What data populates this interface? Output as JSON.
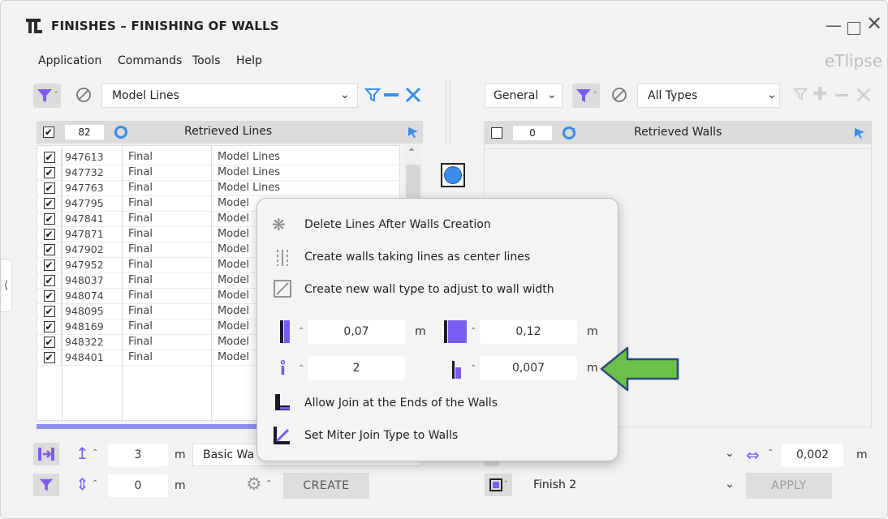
{
  "window": {
    "title": "FINISHES – FINISHING OF WALLS",
    "controls": [
      "minimize",
      "maximize",
      "close"
    ],
    "logo_text": "eTlipse"
  },
  "menu": [
    "Application",
    "Commands",
    "Tools",
    "Help"
  ],
  "left_toolbar": {
    "filter_dropdown_value": "Model Lines",
    "icons": [
      "filter-icon",
      "no-filter-icon",
      "chevron-down-icon",
      "filter-blue-icon",
      "minus-icon",
      "clear-icon"
    ]
  },
  "left_panel": {
    "select_all_checked": true,
    "count": "82",
    "header": "Retrieved Lines",
    "rows": [
      {
        "id": "947613",
        "status": "Final",
        "type": "Model Lines"
      },
      {
        "id": "947732",
        "status": "Final",
        "type": "Model Lines"
      },
      {
        "id": "947763",
        "status": "Final",
        "type": "Model Lines"
      },
      {
        "id": "947795",
        "status": "Final",
        "type": "Model"
      },
      {
        "id": "947841",
        "status": "Final",
        "type": "Model"
      },
      {
        "id": "947871",
        "status": "Final",
        "type": "Model"
      },
      {
        "id": "947902",
        "status": "Final",
        "type": "Model"
      },
      {
        "id": "947952",
        "status": "Final",
        "type": "Model"
      },
      {
        "id": "948037",
        "status": "Final",
        "type": "Model"
      },
      {
        "id": "948074",
        "status": "Final",
        "type": "Model"
      },
      {
        "id": "948095",
        "status": "Final",
        "type": "Model"
      },
      {
        "id": "948169",
        "status": "Final",
        "type": "Model"
      },
      {
        "id": "948322",
        "status": "Final",
        "type": "Model"
      },
      {
        "id": "948401",
        "status": "Final",
        "type": "Model"
      }
    ]
  },
  "right_toolbar": {
    "category_value": "General",
    "types_value": "All Types"
  },
  "right_panel": {
    "select_all_checked": false,
    "count": "0",
    "header": "Retrieved Walls"
  },
  "popup": {
    "options": [
      {
        "icon": "asterisk-delete-icon",
        "label": "Delete Lines After Walls Creation"
      },
      {
        "icon": "center-lines-icon",
        "label": "Create walls taking lines as center lines"
      },
      {
        "icon": "new-wall-type-icon",
        "label": "Create new wall type to adjust to wall width"
      }
    ],
    "params": {
      "thin_width": "0,07",
      "thin_width_unit": "m",
      "thick_width": "0,12",
      "thick_width_unit": "m",
      "count": "2",
      "offset": "0,007",
      "offset_unit": "m"
    },
    "joins": [
      {
        "icon": "join-ends-icon",
        "label": "Allow Join at the Ends of the Walls"
      },
      {
        "icon": "miter-join-icon",
        "label": "Set Miter Join Type to Walls"
      }
    ]
  },
  "bottom_left": {
    "height_value": "3",
    "height_unit": "m",
    "wall_type_value": "Basic Wa",
    "offset_value": "0",
    "offset_unit": "m",
    "create_label": "CREATE"
  },
  "bottom_right": {
    "spacing_value": "0,002",
    "spacing_unit": "m",
    "finish_value": "Finish 2",
    "apply_label": "APPLY"
  },
  "colors": {
    "accent_purple": "#7b5cf0",
    "accent_blue": "#3b8de8",
    "arrow_green": "#6cc04a",
    "arrow_outline": "#2d4a7a"
  }
}
